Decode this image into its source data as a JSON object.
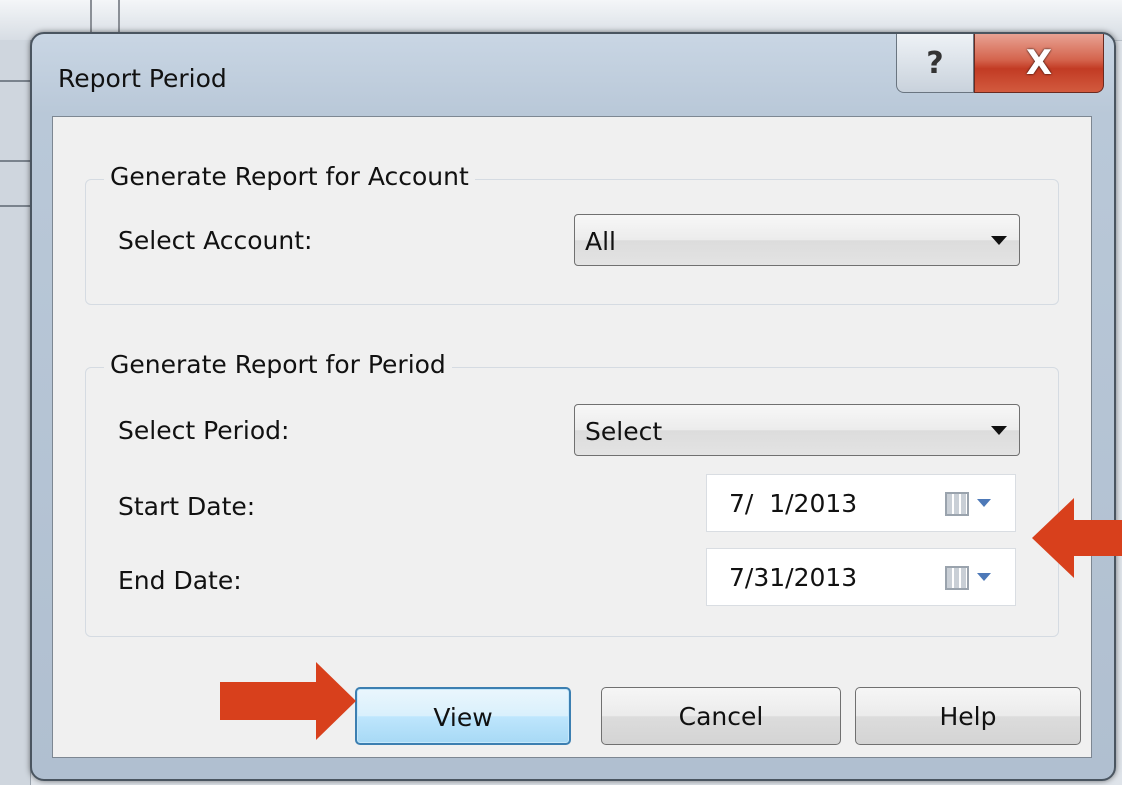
{
  "dialog": {
    "title": "Report Period",
    "help_glyph": "?",
    "close_glyph": "X"
  },
  "account_group": {
    "legend": "Generate Report for Account",
    "select_label": "Select Account:",
    "select_value": "All"
  },
  "period_group": {
    "legend": "Generate Report for Period",
    "select_label": "Select Period:",
    "select_value": "Select",
    "start_label": "Start Date:",
    "start_value": "7/  1/2013",
    "end_label": "End Date:",
    "end_value": "7/31/2013"
  },
  "buttons": {
    "view": "View",
    "cancel": "Cancel",
    "help": "Help"
  },
  "colors": {
    "annotation_arrow": "#d8401c",
    "default_button_border": "#3c7fb1"
  }
}
